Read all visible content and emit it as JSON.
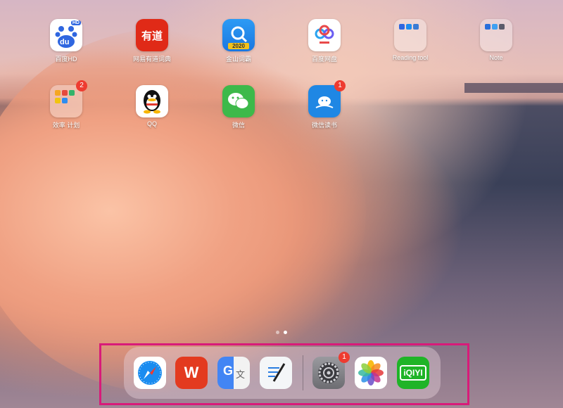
{
  "home_apps": [
    {
      "name": "百度HD",
      "icon": "baidu-icon",
      "color": "#ffffff"
    },
    {
      "name": "网易有道词典",
      "icon": "youdao-icon",
      "color": "#e02a17"
    },
    {
      "name": "金山词霸",
      "icon": "kingsoft-icon",
      "color": "#1e8df0"
    },
    {
      "name": "百度网盘",
      "icon": "baidu-netdisk-icon",
      "color": "#ffffff"
    },
    {
      "name": "Reading tool",
      "icon": "folder-icon",
      "color": "#f0f0f0"
    },
    {
      "name": "Note",
      "icon": "folder-icon",
      "color": "#f0f0f0"
    },
    {
      "name": "效率 计划",
      "icon": "folder-icon",
      "color": "#f0f0f0",
      "badge": "2"
    },
    {
      "name": "QQ",
      "icon": "qq-icon",
      "color": "#ffffff"
    },
    {
      "name": "微信",
      "icon": "wechat-icon",
      "color": "#3db94a"
    },
    {
      "name": "微信读书",
      "icon": "wechat-read-icon",
      "color": "#1f87e4",
      "badge": "1"
    }
  ],
  "tile_text": {
    "baidu": "du",
    "baidu_tag": "HD",
    "youdao": "有道",
    "kingsoft_year": "2020",
    "wps": "W",
    "translate_g": "G",
    "translate_wen": "文",
    "iqiyi": "iQIYI"
  },
  "page_indicator": {
    "count": 2,
    "active": 1
  },
  "dock": {
    "apps": [
      {
        "name": "Safari",
        "icon": "safari-icon"
      },
      {
        "name": "WPS Office",
        "icon": "wps-icon"
      },
      {
        "name": "Google Translate",
        "icon": "google-translate-icon"
      },
      {
        "name": "Notes",
        "icon": "notes-pen-icon"
      },
      {
        "name": "Settings",
        "icon": "settings-icon",
        "badge": "1"
      },
      {
        "name": "Photos",
        "icon": "photos-icon"
      },
      {
        "name": "iQIYI",
        "icon": "iqiyi-icon"
      }
    ]
  }
}
